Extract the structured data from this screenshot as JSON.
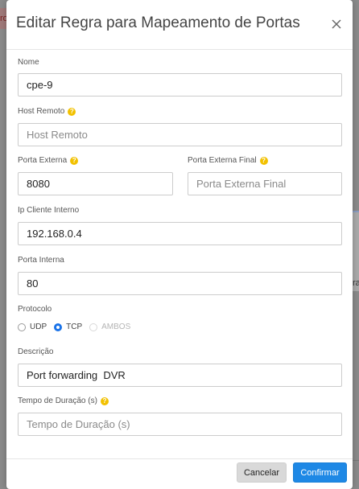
{
  "background": {
    "left_fragment_text": "ro",
    "right_fragment_text": "ra"
  },
  "modal": {
    "title": "Editar Regra para Mapeamento de Portas",
    "close_icon": "close-icon"
  },
  "fields": {
    "nome": {
      "label": "Nome",
      "value": "cpe-9",
      "placeholder": ""
    },
    "host_remoto": {
      "label": "Host Remoto",
      "value": "",
      "placeholder": "Host Remoto"
    },
    "porta_externa": {
      "label": "Porta Externa",
      "value": "8080",
      "placeholder": ""
    },
    "porta_externa_final": {
      "label": "Porta Externa Final",
      "value": "",
      "placeholder": "Porta Externa Final"
    },
    "ip_cliente_interno": {
      "label": "Ip Cliente Interno",
      "value": "192.168.0.4",
      "placeholder": ""
    },
    "porta_interna": {
      "label": "Porta Interna",
      "value": "80",
      "placeholder": ""
    },
    "protocolo": {
      "label": "Protocolo",
      "options": [
        {
          "label": "UDP",
          "checked": false,
          "disabled": false
        },
        {
          "label": "TCP",
          "checked": true,
          "disabled": false
        },
        {
          "label": "AMBOS",
          "checked": false,
          "disabled": true
        }
      ]
    },
    "descricao": {
      "label": "Descrição",
      "value": "Port forwarding  DVR",
      "placeholder": ""
    },
    "tempo_duracao": {
      "label": "Tempo de Duração (s)",
      "value": "",
      "placeholder": "Tempo de Duração (s)"
    }
  },
  "help_icon": "?",
  "footer": {
    "cancel_label": "Cancelar",
    "confirm_label": "Confirmar"
  },
  "colors": {
    "accent": "#1e88e5",
    "help_icon": "#f2c100",
    "radio_checked": "#1a73e8"
  }
}
